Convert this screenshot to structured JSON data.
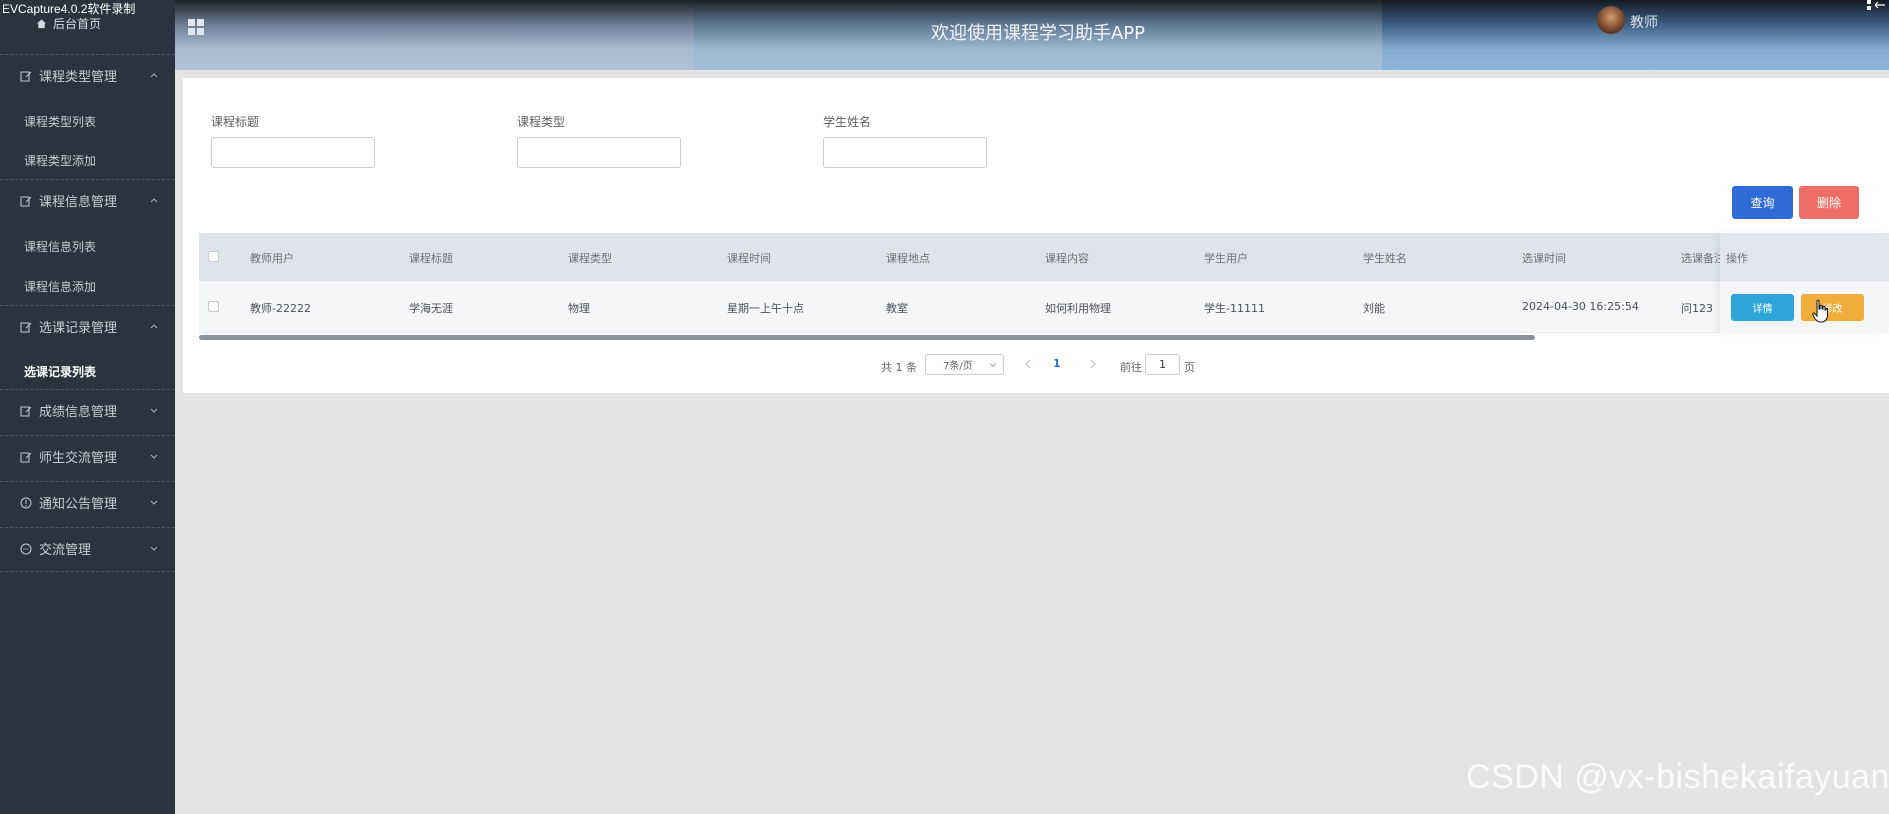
{
  "recorder_label": "EVCapture4.0.2软件录制",
  "sidebar": {
    "home": "后台首页",
    "groups": [
      {
        "label": "课程类型管理",
        "sub": [
          "课程类型列表",
          "课程类型添加"
        ]
      },
      {
        "label": "课程信息管理",
        "sub": [
          "课程信息列表",
          "课程信息添加"
        ]
      },
      {
        "label": "选课记录管理",
        "sub": [
          "选课记录列表"
        ]
      },
      {
        "label": "成绩信息管理",
        "sub": []
      },
      {
        "label": "师生交流管理",
        "sub": []
      },
      {
        "label": "通知公告管理",
        "sub": []
      },
      {
        "label": "交流管理",
        "sub": []
      }
    ],
    "active_item": "选课记录列表"
  },
  "header": {
    "title": "欢迎使用课程学习助手APP",
    "user": "教师"
  },
  "filters": [
    {
      "label": "课程标题",
      "value": ""
    },
    {
      "label": "课程类型",
      "value": ""
    },
    {
      "label": "学生姓名",
      "value": ""
    }
  ],
  "buttons": {
    "query": "查询",
    "delete": "删除"
  },
  "table": {
    "columns": [
      "教师用户",
      "课程标题",
      "课程类型",
      "课程时间",
      "课程地点",
      "课程内容",
      "学生用户",
      "学生姓名",
      "选课时间",
      "选课备注",
      "操作"
    ],
    "rows": [
      [
        "教师-22222",
        "学海无涯",
        "物理",
        "星期一上午十点",
        "教室",
        "如何利用物理",
        "学生-11111",
        "刘能",
        "2024-04-30 16:25:54",
        "问123"
      ]
    ],
    "row_actions": {
      "detail": "详情",
      "edit": "修改"
    }
  },
  "pagination": {
    "total": "共 1 条",
    "page_size": "7条/页",
    "current_page": "1",
    "goto_prefix": "前往",
    "goto_value": "1",
    "goto_suffix": "页"
  },
  "watermark": "CSDN @vx-bishekaifayuan",
  "colors": {
    "sidebar_bg": "#2b3340",
    "primary": "#2e6bd6",
    "danger": "#ef6f68",
    "info": "#2fa6da",
    "warning": "#f0ad3c"
  }
}
